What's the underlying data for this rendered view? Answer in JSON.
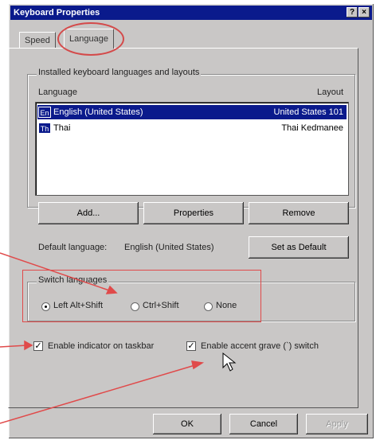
{
  "window": {
    "title": "Keyboard Properties",
    "help_glyph": "?",
    "close_glyph": "×"
  },
  "tabs": [
    {
      "label": "Speed"
    },
    {
      "label": "Language"
    }
  ],
  "installed_group": {
    "label": "Installed keyboard languages and layouts",
    "col_language": "Language",
    "col_layout": "Layout",
    "rows": [
      {
        "code": "En",
        "name": "English (United States)",
        "layout": "United States 101",
        "selected": true
      },
      {
        "code": "Th",
        "name": "Thai",
        "layout": "Thai Kedmanee",
        "selected": false
      }
    ]
  },
  "buttons": {
    "add": "Add...",
    "properties": "Properties",
    "remove": "Remove",
    "set_default": "Set as Default"
  },
  "default_language": {
    "label": "Default language:",
    "value": "English (United States)"
  },
  "switch_group": {
    "label": "Switch languages",
    "options": [
      {
        "label": "Left Alt+Shift",
        "checked": true
      },
      {
        "label": "Ctrl+Shift",
        "checked": false
      },
      {
        "label": "None",
        "checked": false
      }
    ]
  },
  "indicator_checkbox": {
    "label": "Enable indicator on taskbar",
    "checked": true,
    "mark": "✓"
  },
  "accent_checkbox": {
    "label": "Enable accent grave (`) switch",
    "checked": true,
    "mark": "✓"
  },
  "footer": {
    "ok": "OK",
    "cancel": "Cancel",
    "apply": "Apply"
  },
  "icons": {
    "cursor": "mouse-pointer-icon"
  },
  "colors": {
    "annotation_red": "#e04a4a",
    "title_blue": "#0a1a8c",
    "dialog_gray": "#c9c7c6"
  }
}
